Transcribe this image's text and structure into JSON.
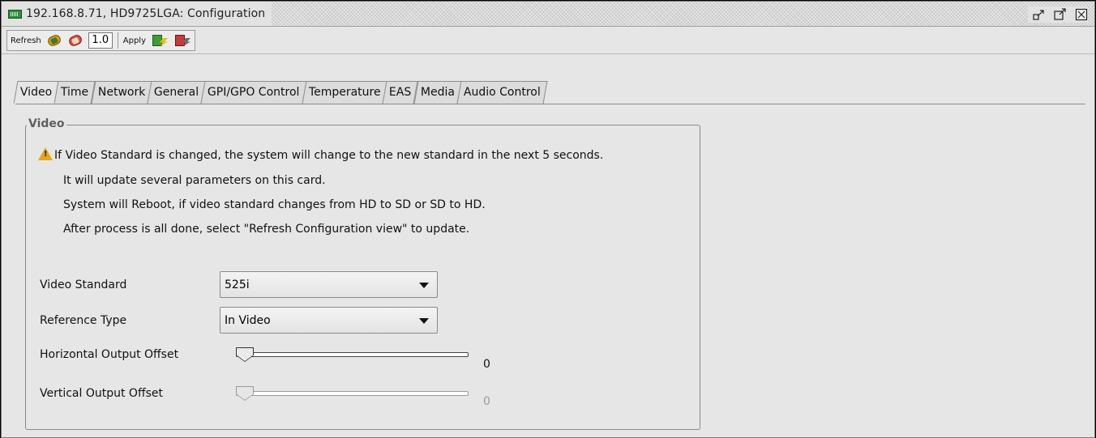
{
  "window": {
    "title": "192.168.8.71, HD9725LGA: Configuration",
    "controls": [
      "restore-icon",
      "maximize-icon",
      "close-icon"
    ]
  },
  "toolbar": {
    "refresh_label": "Refresh",
    "zoom_value": "1.0",
    "apply_label": "Apply"
  },
  "tabs": [
    {
      "label": "Video",
      "active": true
    },
    {
      "label": "Time"
    },
    {
      "label": "Network"
    },
    {
      "label": "General"
    },
    {
      "label": "GPI/GPO Control"
    },
    {
      "label": "Temperature"
    },
    {
      "label": "EAS"
    },
    {
      "label": "Media"
    },
    {
      "label": "Audio Control"
    }
  ],
  "panel": {
    "legend": "Video",
    "messages": [
      "If Video Standard is changed, the system will change to the new standard in the next 5 seconds.",
      "It will update several parameters on this card.",
      "System will Reboot, if video standard changes from HD to SD or SD to HD.",
      "After process is all done, select \"Refresh Configuration view\" to update."
    ],
    "video_standard": {
      "label": "Video Standard",
      "value": "525i"
    },
    "reference_type": {
      "label": "Reference Type",
      "value": "In Video"
    },
    "horizontal_offset": {
      "label": "Horizontal Output Offset",
      "value": "0",
      "enabled": true
    },
    "vertical_offset": {
      "label": "Vertical Output Offset",
      "value": "0",
      "enabled": false
    }
  },
  "colors": {
    "background": "#e6e6e6",
    "warning": "#e7a51a"
  }
}
